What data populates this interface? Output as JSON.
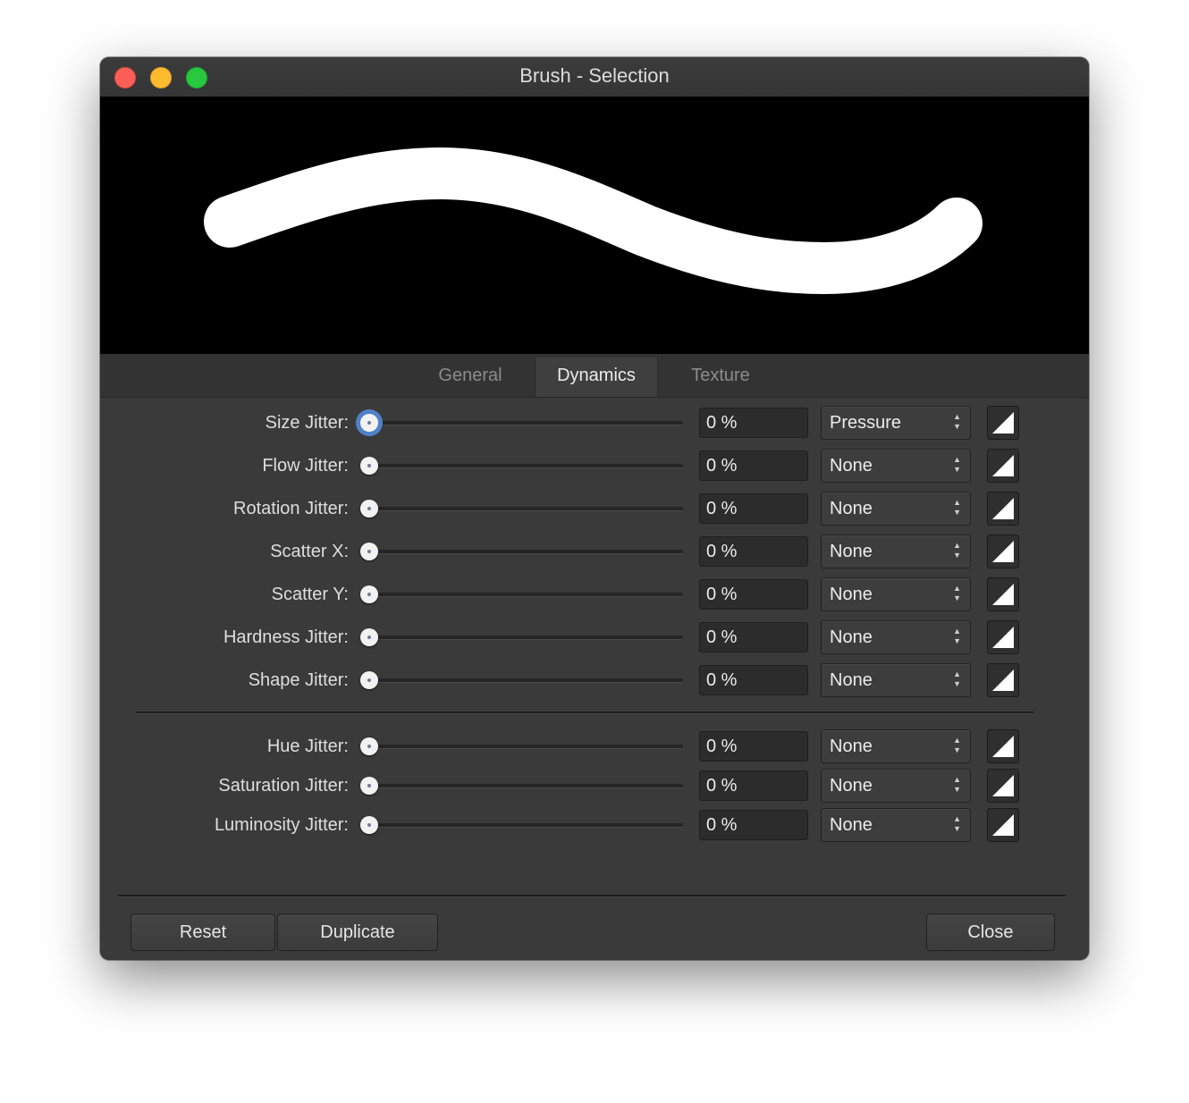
{
  "window": {
    "title": "Brush - Selection"
  },
  "tabs": [
    {
      "label": "General",
      "active": false
    },
    {
      "label": "Dynamics",
      "active": true
    },
    {
      "label": "Texture",
      "active": false
    }
  ],
  "rows": [
    {
      "label": "Size Jitter:",
      "value": "0 %",
      "controller": "Pressure",
      "slider_fraction": 0
    },
    {
      "label": "Flow Jitter:",
      "value": "0 %",
      "controller": "None",
      "slider_fraction": 0
    },
    {
      "label": "Rotation Jitter:",
      "value": "0 %",
      "controller": "None",
      "slider_fraction": 0
    },
    {
      "label": "Scatter X:",
      "value": "0 %",
      "controller": "None",
      "slider_fraction": 0
    },
    {
      "label": "Scatter Y:",
      "value": "0 %",
      "controller": "None",
      "slider_fraction": 0
    },
    {
      "label": "Hardness Jitter:",
      "value": "0 %",
      "controller": "None",
      "slider_fraction": 0
    },
    {
      "label": "Shape Jitter:",
      "value": "0 %",
      "controller": "None",
      "slider_fraction": 0
    },
    {
      "label": "Hue Jitter:",
      "value": "0 %",
      "controller": "None",
      "slider_fraction": 0
    },
    {
      "label": "Saturation Jitter:",
      "value": "0 %",
      "controller": "None",
      "slider_fraction": 0
    },
    {
      "label": "Luminosity Jitter:",
      "value": "0 %",
      "controller": "None",
      "slider_fraction": 0
    }
  ],
  "buttons": {
    "reset": "Reset",
    "duplicate": "Duplicate",
    "close": "Close"
  },
  "icons": {
    "select_arrows": "updown-chevron-icon",
    "curve": "pressure-curve-icon"
  },
  "colors": {
    "focus_ring": "#5081c8",
    "panel": "#3a3a3a",
    "preview_bg": "#000000",
    "stroke": "#ffffff"
  }
}
